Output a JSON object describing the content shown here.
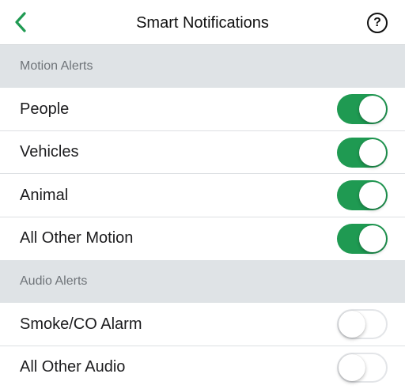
{
  "header": {
    "title": "Smart Notifications",
    "help_glyph": "?"
  },
  "colors": {
    "accent": "#1f9a52",
    "section_bg": "#dfe3e6"
  },
  "sections": [
    {
      "title": "Motion Alerts",
      "items": [
        {
          "label": "People",
          "enabled": true
        },
        {
          "label": "Vehicles",
          "enabled": true
        },
        {
          "label": "Animal",
          "enabled": true
        },
        {
          "label": "All Other Motion",
          "enabled": true
        }
      ]
    },
    {
      "title": "Audio Alerts",
      "items": [
        {
          "label": "Smoke/CO Alarm",
          "enabled": false
        },
        {
          "label": "All Other Audio",
          "enabled": false
        }
      ]
    }
  ]
}
